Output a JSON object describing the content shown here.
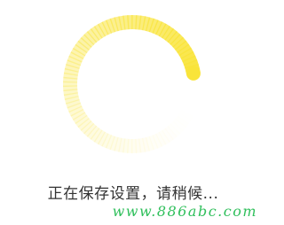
{
  "dialog": {
    "status_text": "正在保存设置，请稍候...",
    "watermark_text": "www.886abc.com"
  },
  "spinner": {
    "icon": "loading-spinner-icon",
    "color": "#f9e43a"
  },
  "colors": {
    "background": "#ffffff",
    "text": "#333333",
    "watermark": "#2fbf5b"
  }
}
